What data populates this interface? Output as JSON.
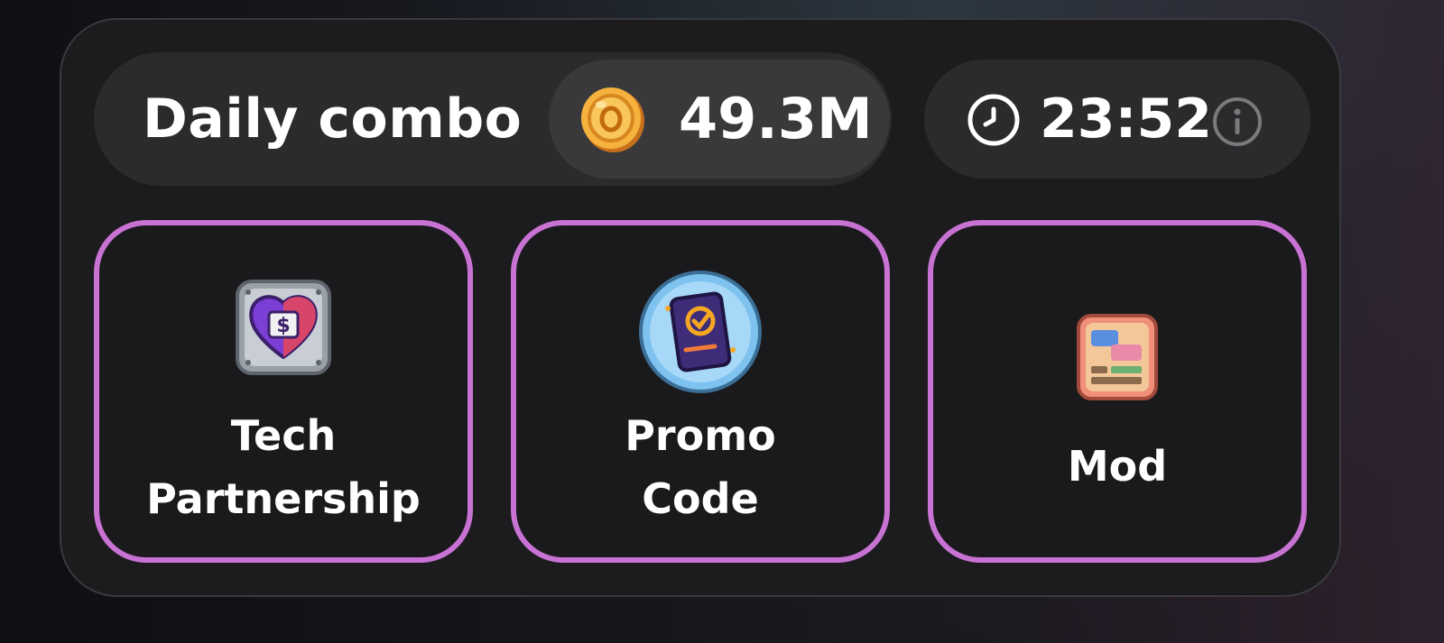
{
  "header": {
    "title": "Daily combo",
    "reward": "49.3M",
    "timer": "23:52"
  },
  "icons": {
    "coin": "coin-icon",
    "clock": "clock-icon",
    "info": "info-icon"
  },
  "cards": [
    {
      "label": "Tech\nPartnership",
      "icon": "tech-partnership-icon"
    },
    {
      "label": "Promo\nCode",
      "icon": "promo-code-icon"
    },
    {
      "label": "Mod",
      "icon": "mod-icon"
    }
  ],
  "colors": {
    "card_border": "#c872d4",
    "panel": "#1c1c1e",
    "pill": "#2b2b2d",
    "coin": "#f2a93b"
  }
}
